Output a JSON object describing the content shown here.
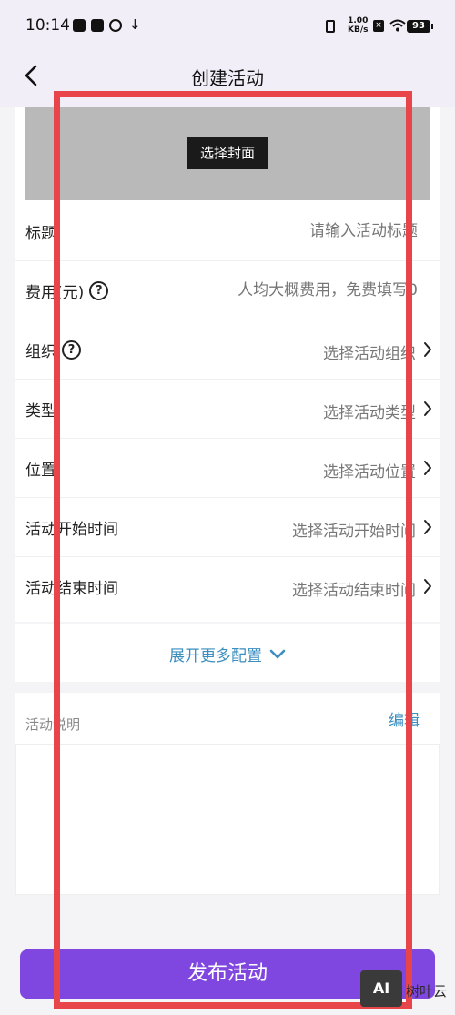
{
  "status_bar": {
    "time": "10:14",
    "net_speed_value": "1.00",
    "net_speed_unit": "KB/s",
    "battery": "93"
  },
  "nav": {
    "title": "创建活动"
  },
  "cover": {
    "button_label": "选择封面"
  },
  "form": {
    "rows": [
      {
        "label": "标题",
        "placeholder": "请输入活动标题",
        "help": false,
        "chevron": false
      },
      {
        "label": "费用(元)",
        "placeholder": "人均大概费用，免费填写0",
        "help": true,
        "chevron": false
      },
      {
        "label": "组织",
        "value": "选择活动组织",
        "help": true,
        "chevron": true
      },
      {
        "label": "类型",
        "value": "选择活动类型",
        "help": false,
        "chevron": true
      },
      {
        "label": "位置",
        "value": "选择活动位置",
        "help": false,
        "chevron": true
      },
      {
        "label": "活动开始时间",
        "value": "选择活动开始时间",
        "help": false,
        "chevron": true
      },
      {
        "label": "活动结束时间",
        "value": "选择活动结束时间",
        "help": false,
        "chevron": true
      }
    ],
    "help_glyph": "?"
  },
  "expand": {
    "label": "展开更多配置"
  },
  "description": {
    "label": "活动说明",
    "edit_label": "编辑"
  },
  "publish": {
    "label": "发布活动"
  },
  "watermark": {
    "logo": "AI",
    "text": "树叶云"
  },
  "colors": {
    "accent_blue": "#3a8ec0",
    "publish_purple": "#8047e0",
    "annotation_red": "#e8454a",
    "cover_gray": "#b9b9b9"
  },
  "icons": [
    "back-arrow-icon",
    "help-circle-icon",
    "chevron-right-icon",
    "chevron-down-icon",
    "wifi-icon",
    "vibrate-icon",
    "download-icon"
  ]
}
